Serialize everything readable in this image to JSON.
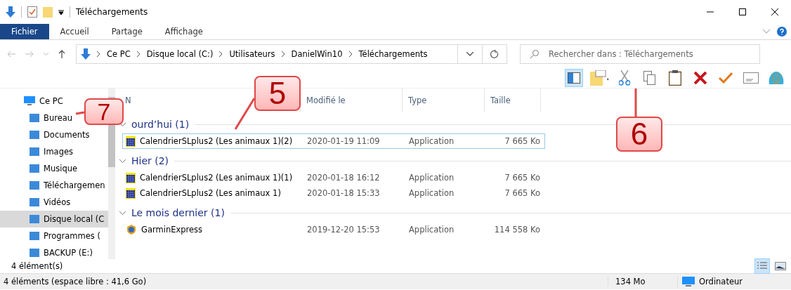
{
  "window": {
    "title": "Téléchargements"
  },
  "ribbon_tabs": [
    {
      "label": "Fichier",
      "selected": true
    },
    {
      "label": "Accueil",
      "selected": false
    },
    {
      "label": "Partage",
      "selected": false
    },
    {
      "label": "Affichage",
      "selected": false
    }
  ],
  "address_bar": {
    "crumbs": [
      "Ce PC",
      "Disque local (C:)",
      "Utilisateurs",
      "DanielWin10",
      "Téléchargements"
    ]
  },
  "search": {
    "placeholder": "Rechercher dans : Téléchargements"
  },
  "sidebar": {
    "items": [
      {
        "label": "Ce PC",
        "selected": false,
        "children": [
          {
            "label": "Bureau",
            "selected": false
          },
          {
            "label": "Documents",
            "selected": false
          },
          {
            "label": "Images",
            "selected": false
          },
          {
            "label": "Musique",
            "selected": false
          },
          {
            "label": "Téléchargemen",
            "selected": false
          },
          {
            "label": "Vidéos",
            "selected": false
          },
          {
            "label": "Disque local (C",
            "selected": true
          },
          {
            "label": "Programmes (",
            "selected": false
          },
          {
            "label": "BACKUP (E:)",
            "selected": false
          }
        ]
      }
    ]
  },
  "table": {
    "columns": [
      "N",
      "Modifié le",
      "Type",
      "Taille"
    ],
    "groups": [
      {
        "label": "ourd’hui (1)",
        "rows": [
          {
            "name": "CalendrierSLplus2 (Les animaux 1)(2)",
            "modified": "2020-01-19 11:09",
            "type": "Application",
            "size": "7 665 Ko",
            "selected": true,
            "kind": "calendar"
          }
        ]
      },
      {
        "label": "Hier (2)",
        "rows": [
          {
            "name": "CalendrierSLplus2 (Les animaux 1)(1)",
            "modified": "2020-01-18 16:12",
            "type": "Application",
            "size": "7 665 Ko",
            "selected": false,
            "kind": "calendar"
          },
          {
            "name": "CalendrierSLplus2 (Les animaux 1)",
            "modified": "2020-01-18 15:33",
            "type": "Application",
            "size": "7 665 Ko",
            "selected": false,
            "kind": "calendar"
          }
        ]
      },
      {
        "label": "Le mois dernier (1)",
        "rows": [
          {
            "name": "GarminExpress",
            "modified": "2019-12-20 15:53",
            "type": "Application",
            "size": "114 558 Ko",
            "selected": false,
            "kind": "garmin"
          }
        ]
      }
    ]
  },
  "item_count": "4 élément(s)",
  "status_bar": {
    "summary": "4 éléments (espace libre : 41,6 Go)",
    "size": "134 Mo",
    "location": "Ordinateur"
  },
  "callouts": [
    {
      "label": "5"
    },
    {
      "label": "7"
    },
    {
      "label": "6"
    }
  ]
}
